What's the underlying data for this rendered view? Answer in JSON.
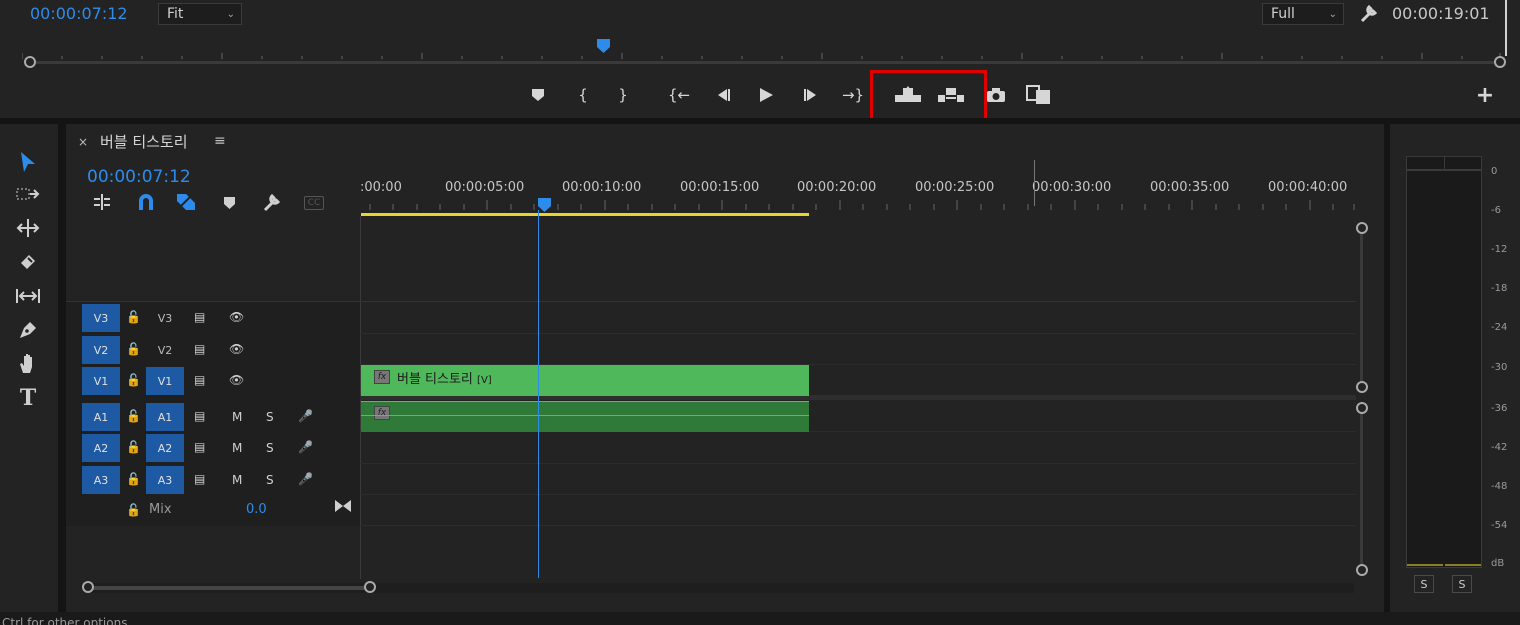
{
  "monitor": {
    "timecode_current": "00:00:07:12",
    "zoom_select": "Fit",
    "resolution_select": "Full",
    "timecode_duration": "00:00:19:01",
    "transport_icons": [
      "marker-icon",
      "mark-in-icon",
      "mark-out-icon",
      "go-to-in-icon",
      "step-back-icon",
      "play-icon",
      "step-forward-icon",
      "go-to-out-icon",
      "lift-icon",
      "extract-icon",
      "export-frame-icon",
      "comparison-view-icon",
      "add-button-icon"
    ]
  },
  "tools": [
    "selection-tool-icon",
    "track-select-forward-tool-icon",
    "ripple-edit-tool-icon",
    "razor-tool-icon",
    "slip-tool-icon",
    "pen-tool-icon",
    "hand-tool-icon",
    "type-tool-icon"
  ],
  "timeline": {
    "close_label": "×",
    "sequence_name": "버블 티스토리",
    "menu_label": "≡",
    "timecode": "00:00:07:12",
    "ruler_labels": [
      ":00:00",
      "00:00:05:00",
      "00:00:10:00",
      "00:00:15:00",
      "00:00:20:00",
      "00:00:25:00",
      "00:00:30:00",
      "00:00:35:00",
      "00:00:40:00"
    ],
    "video_tracks": [
      {
        "source": "V3",
        "target": "V3"
      },
      {
        "source": "V2",
        "target": "V2"
      },
      {
        "source": "V1",
        "target": "V1"
      }
    ],
    "audio_tracks": [
      {
        "source": "A1",
        "target": "A1",
        "mute": "M",
        "solo": "S"
      },
      {
        "source": "A2",
        "target": "A2",
        "mute": "M",
        "solo": "S"
      },
      {
        "source": "A3",
        "target": "A3",
        "mute": "M",
        "solo": "S"
      }
    ],
    "mix_label": "Mix",
    "mix_value": "0.0",
    "video_clip": {
      "fx": "fx",
      "name": "버블 티스토리",
      "tag": "[V]"
    },
    "audio_clip": {
      "fx": "fx"
    }
  },
  "meter": {
    "db_labels": [
      "0",
      "-6",
      "-12",
      "-18",
      "-24",
      "-30",
      "-36",
      "-42",
      "-48",
      "-54",
      "dB"
    ],
    "solo_left": "S",
    "solo_right": "S"
  },
  "status": {
    "text": "Ctrl for other options"
  },
  "colors": {
    "accent": "#2d8ceb",
    "clip_video": "#4fb85a",
    "clip_audio": "#2f7a39",
    "work_area": "#e8d42c",
    "highlight": "#e00000"
  }
}
